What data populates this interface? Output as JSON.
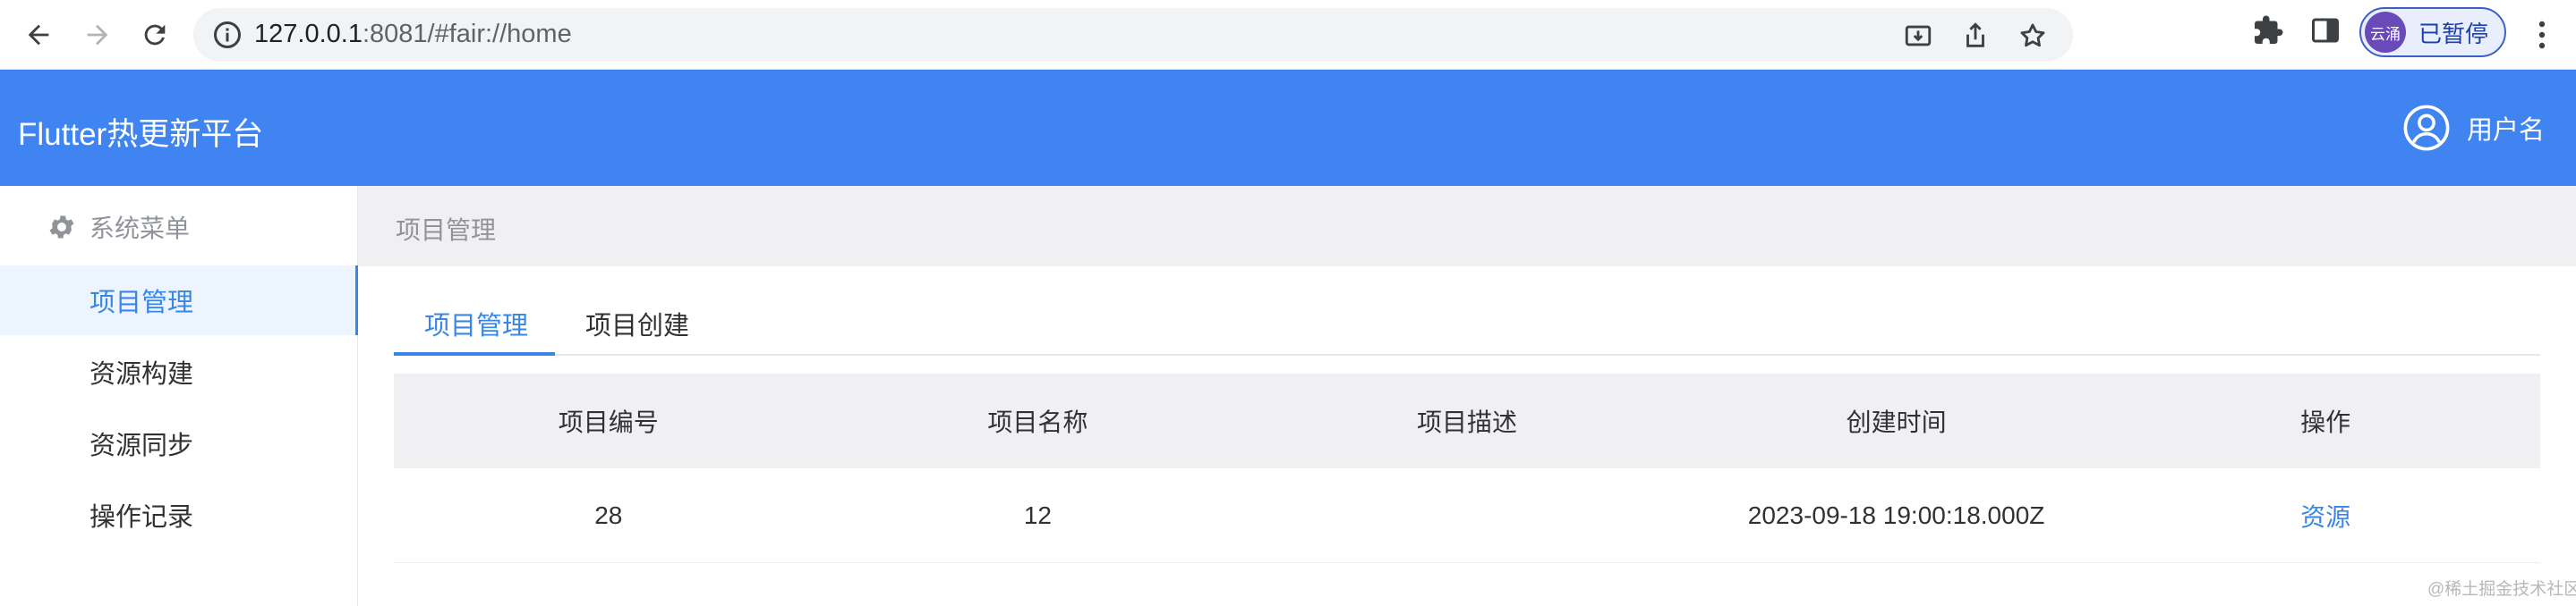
{
  "browser": {
    "url_host": "127.0.0.1",
    "url_rest": ":8081/#fair://home",
    "profile_avatar_text": "云涌",
    "profile_status": "已暂停"
  },
  "header": {
    "title": "Flutter热更新平台",
    "username": "用户名"
  },
  "sidebar": {
    "menu_title": "系统菜单",
    "items": [
      {
        "label": "项目管理"
      },
      {
        "label": "资源构建"
      },
      {
        "label": "资源同步"
      },
      {
        "label": "操作记录"
      }
    ]
  },
  "breadcrumb": "项目管理",
  "tabs": [
    {
      "label": "项目管理"
    },
    {
      "label": "项目创建"
    }
  ],
  "table": {
    "columns": [
      "项目编号",
      "项目名称",
      "项目描述",
      "创建时间",
      "操作"
    ],
    "rows": [
      {
        "id": "28",
        "name": "12",
        "description": "",
        "created_at": "2023-09-18 19:00:18.000Z",
        "action": "资源"
      }
    ]
  },
  "watermark": "@稀土掘金技术社区",
  "colors": {
    "header_bg": "#3f84f0",
    "accent": "#3a86e6",
    "active_menu_bg": "#ecf5ff",
    "breadcrumb_bg": "#f0f0f2"
  }
}
